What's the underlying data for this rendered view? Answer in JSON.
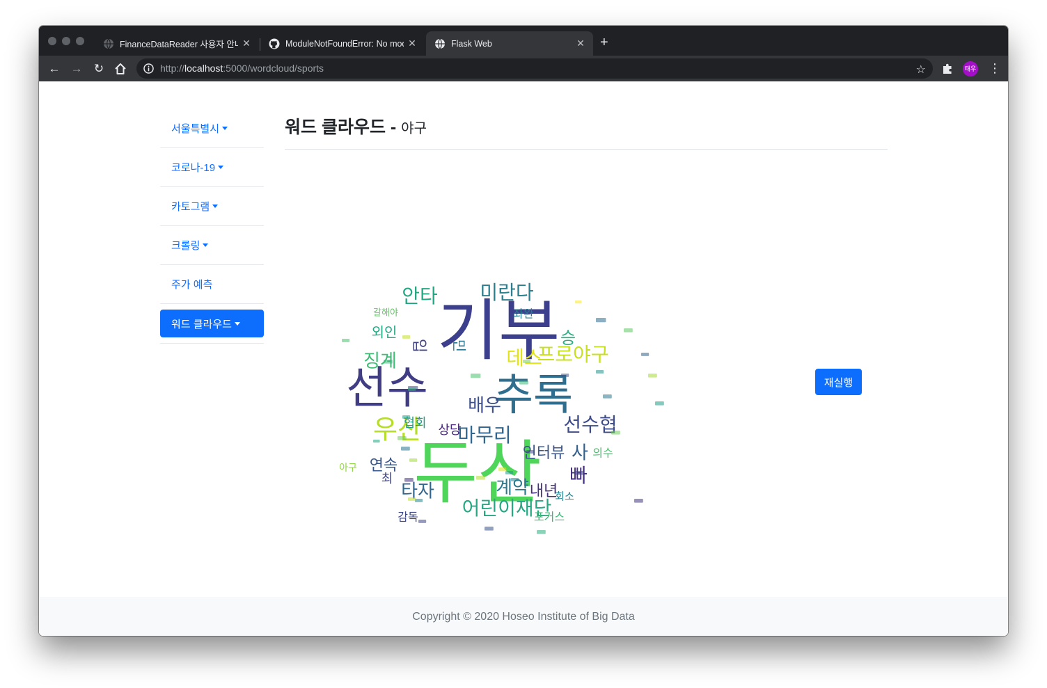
{
  "browser": {
    "tabs": [
      {
        "title": "FinanceDataReader 사용자 안내서",
        "favicon": "globe-icon",
        "active": false
      },
      {
        "title": "ModuleNotFoundError: No module",
        "favicon": "github-icon",
        "active": false
      },
      {
        "title": "Flask Web",
        "favicon": "globe-icon",
        "active": true
      }
    ],
    "url_scheme": "http://",
    "url_host": "localhost",
    "url_path": ":5000/wordcloud/sports",
    "profile_initials": "태우"
  },
  "sidebar": {
    "items": [
      {
        "label": "서울특별시",
        "dropdown": true
      },
      {
        "label": "코로나-19",
        "dropdown": true
      },
      {
        "label": "카토그램",
        "dropdown": true
      },
      {
        "label": "크롤링",
        "dropdown": true
      },
      {
        "label": "주가 예측",
        "dropdown": false
      },
      {
        "label": "워드 클라우드",
        "dropdown": true,
        "active": true
      }
    ]
  },
  "main": {
    "title": "워드 클라우드 -",
    "subtitle": "야구",
    "rerun_label": "재실행"
  },
  "wordcloud": {
    "words": [
      {
        "text": "기부",
        "color": "#3b3f8c"
      },
      {
        "text": "두산",
        "color": "#4fd65a"
      },
      {
        "text": "선수",
        "color": "#413d84"
      },
      {
        "text": "추록",
        "color": "#2f6e8e"
      },
      {
        "text": "미란다",
        "color": "#2c7f8e"
      },
      {
        "text": "안타",
        "color": "#23a884"
      },
      {
        "text": "우산",
        "color": "#b5de2b"
      },
      {
        "text": "프로야구",
        "color": "#c8e020"
      },
      {
        "text": "데스",
        "color": "#e2e418"
      },
      {
        "text": "선수협",
        "color": "#3e4c8a"
      },
      {
        "text": "어린이재단",
        "color": "#26a884"
      },
      {
        "text": "마무리",
        "color": "#31668e"
      },
      {
        "text": "징계",
        "color": "#3dbc74"
      },
      {
        "text": "외인",
        "color": "#22a884"
      },
      {
        "text": "배우",
        "color": "#3c4f8a"
      },
      {
        "text": "계약",
        "color": "#2a788e"
      },
      {
        "text": "타자",
        "color": "#31678e"
      },
      {
        "text": "연속",
        "color": "#38588c"
      },
      {
        "text": "내년",
        "color": "#46317e"
      },
      {
        "text": "인터뷰",
        "color": "#3a548c"
      },
      {
        "text": "협회",
        "color": "#1f9e89"
      },
      {
        "text": "상당",
        "color": "#482878"
      },
      {
        "text": "승",
        "color": "#29af7f"
      },
      {
        "text": "빠",
        "color": "#46327e"
      },
      {
        "text": "사",
        "color": "#355f8d"
      },
      {
        "text": "포커스",
        "color": "#3aba76"
      },
      {
        "text": "감독",
        "color": "#3f4889"
      },
      {
        "text": "회소",
        "color": "#26828e"
      },
      {
        "text": "의수",
        "color": "#4ac16d"
      },
      {
        "text": "좌완",
        "color": "#297b8e"
      },
      {
        "text": "입",
        "color": "#414487"
      },
      {
        "text": "갈해야",
        "color": "#5ec962"
      },
      {
        "text": "아구",
        "color": "#90d743"
      },
      {
        "text": "최",
        "color": "#404688"
      },
      {
        "text": "민",
        "color": "#2b758e"
      }
    ]
  },
  "footer": {
    "text": "Copyright © 2020 Hoseo Institute of Big Data"
  }
}
